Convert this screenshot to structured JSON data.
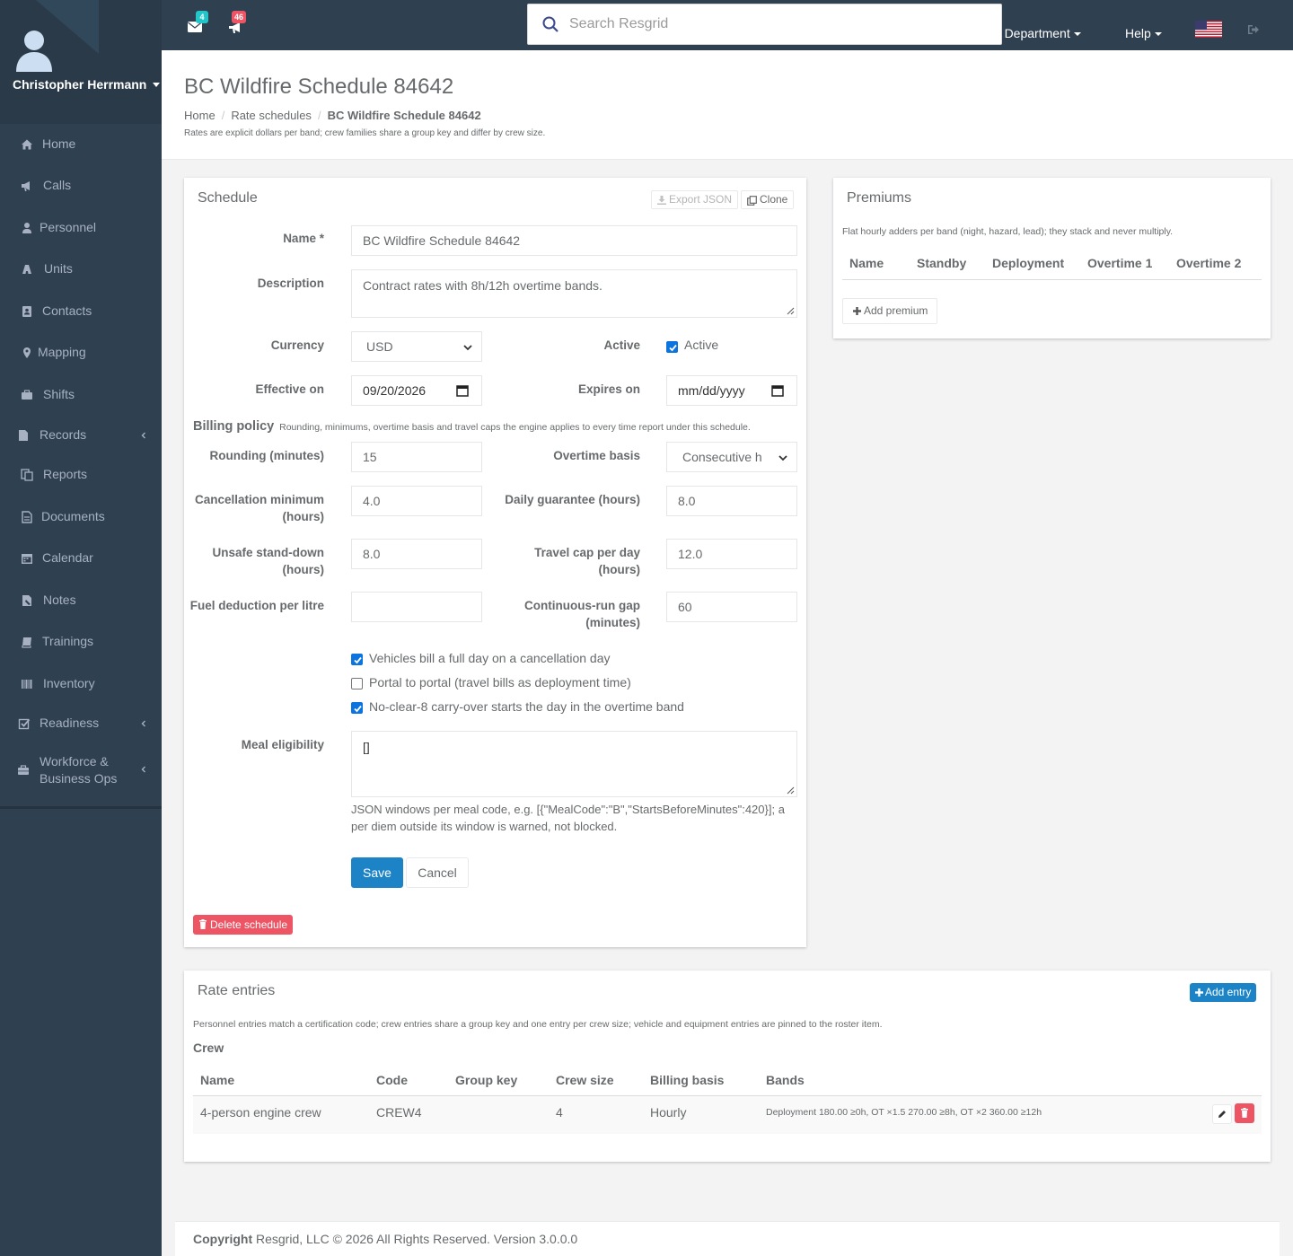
{
  "user": {
    "name": "Christopher Herrmann"
  },
  "nav": [
    {
      "label": "Home",
      "icon": "home-icon"
    },
    {
      "label": "Calls",
      "icon": "bullhorn-icon"
    },
    {
      "label": "Personnel",
      "icon": "user-icon"
    },
    {
      "label": "Units",
      "icon": "truck-icon"
    },
    {
      "label": "Contacts",
      "icon": "address-book-icon"
    },
    {
      "label": "Mapping",
      "icon": "map-marker-icon"
    },
    {
      "label": "Shifts",
      "icon": "shifts-icon"
    },
    {
      "label": "Records",
      "icon": "file-icon"
    },
    {
      "label": "Reports",
      "icon": "reports-icon"
    },
    {
      "label": "Documents",
      "icon": "document-icon"
    },
    {
      "label": "Calendar",
      "icon": "calendar-icon"
    },
    {
      "label": "Notes",
      "icon": "notes-icon"
    },
    {
      "label": "Trainings",
      "icon": "book-icon"
    },
    {
      "label": "Inventory",
      "icon": "barcode-icon"
    },
    {
      "label": "Readiness",
      "icon": "check-square-icon"
    },
    {
      "label": "Workforce &",
      "label2": "Business Ops",
      "icon": "briefcase-icon"
    }
  ],
  "topbar": {
    "messages_count": "4",
    "alerts_count": "46",
    "search_placeholder": "Search Resgrid",
    "department": "Test Department",
    "help": "Help",
    "accent": "#1c84c6",
    "danger": "#ed5565",
    "teal": "#23c6c8"
  },
  "header": {
    "title": "BC Wildfire Schedule 84642",
    "breadcrumbs": [
      "Home",
      "Rate schedules",
      "BC Wildfire Schedule 84642"
    ],
    "subtitle": "Rates are explicit dollars per band; crew families share a group key and differ by crew size."
  },
  "schedule": {
    "title": "Schedule",
    "export_label": "Export JSON",
    "clone_label": "Clone",
    "name_label": "Name",
    "required_mark": "*",
    "name_value": "BC Wildfire Schedule 84642",
    "description_label": "Description",
    "description_value": "Contract rates with 8h/12h overtime bands.",
    "currency_label": "Currency",
    "currency_value": "USD",
    "active_label": "Active",
    "active_checkbox_label": "Active",
    "active_checked": true,
    "effective_label": "Effective on",
    "effective_value": "09/20/2026",
    "expires_label": "Expires on",
    "expires_placeholder": "mm/dd/yyyy",
    "billing_title": "Billing policy",
    "billing_help": "Rounding, minimums, overtime basis and travel caps the engine applies to every time report under this schedule.",
    "rounding_label": "Rounding (minutes)",
    "rounding_value": "15",
    "ot_basis_label": "Overtime basis",
    "ot_basis_value": "Consecutive h",
    "cancel_min_label": "Cancellation minimum",
    "cancel_min_label2": "(hours)",
    "cancel_min_value": "4.0",
    "daily_guarantee_label": "Daily guarantee (hours)",
    "daily_guarantee_value": "8.0",
    "unsafe_label": "Unsafe stand-down",
    "unsafe_label2": "(hours)",
    "unsafe_value": "8.0",
    "travel_cap_label": "Travel cap per day",
    "travel_cap_label2": "(hours)",
    "travel_cap_value": "12.0",
    "fuel_label": "Fuel deduction per litre",
    "fuel_value": "",
    "gap_label": "Continuous-run gap",
    "gap_label2": "(minutes)",
    "gap_value": "60",
    "checkboxes": [
      {
        "label": "Vehicles bill a full day on a cancellation day",
        "checked": true
      },
      {
        "label": "Portal to portal (travel bills as deployment time)",
        "checked": false
      },
      {
        "label": "No-clear-8 carry-over starts the day in the overtime band",
        "checked": true
      }
    ],
    "meal_label": "Meal eligibility",
    "meal_value": "[]",
    "meal_help": "JSON windows per meal code, e.g. [{\"MealCode\":\"B\",\"StartsBeforeMinutes\":420}]; a per diem outside its window is warned, not blocked.",
    "save_label": "Save",
    "cancel_label": "Cancel",
    "delete_label": "Delete schedule"
  },
  "premiums": {
    "title": "Premiums",
    "help": "Flat hourly adders per band (night, hazard, lead); they stack and never multiply.",
    "columns": [
      "Name",
      "Standby",
      "Deployment",
      "Overtime 1",
      "Overtime 2"
    ],
    "add_label": "Add premium"
  },
  "rates": {
    "title": "Rate entries",
    "add_label": "Add entry",
    "help": "Personnel entries match a certification code; crew entries share a group key and one entry per crew size; vehicle and equipment entries are pinned to the roster item.",
    "section": "Crew",
    "columns": [
      "Name",
      "Code",
      "Group key",
      "Crew size",
      "Billing basis",
      "Bands"
    ],
    "rows": [
      {
        "name": "4-person engine crew",
        "code": "CREW4",
        "group_key": "",
        "crew_size": "4",
        "billing_basis": "Hourly",
        "bands": "Deployment 180.00 ≥0h, OT ×1.5 270.00 ≥8h, OT ×2 360.00 ≥12h"
      }
    ]
  },
  "footer": {
    "copyright_strong": "Copyright",
    "copyright": "Resgrid, LLC © 2026 All Rights Reserved.",
    "version": "Version 3.0.0.0"
  }
}
